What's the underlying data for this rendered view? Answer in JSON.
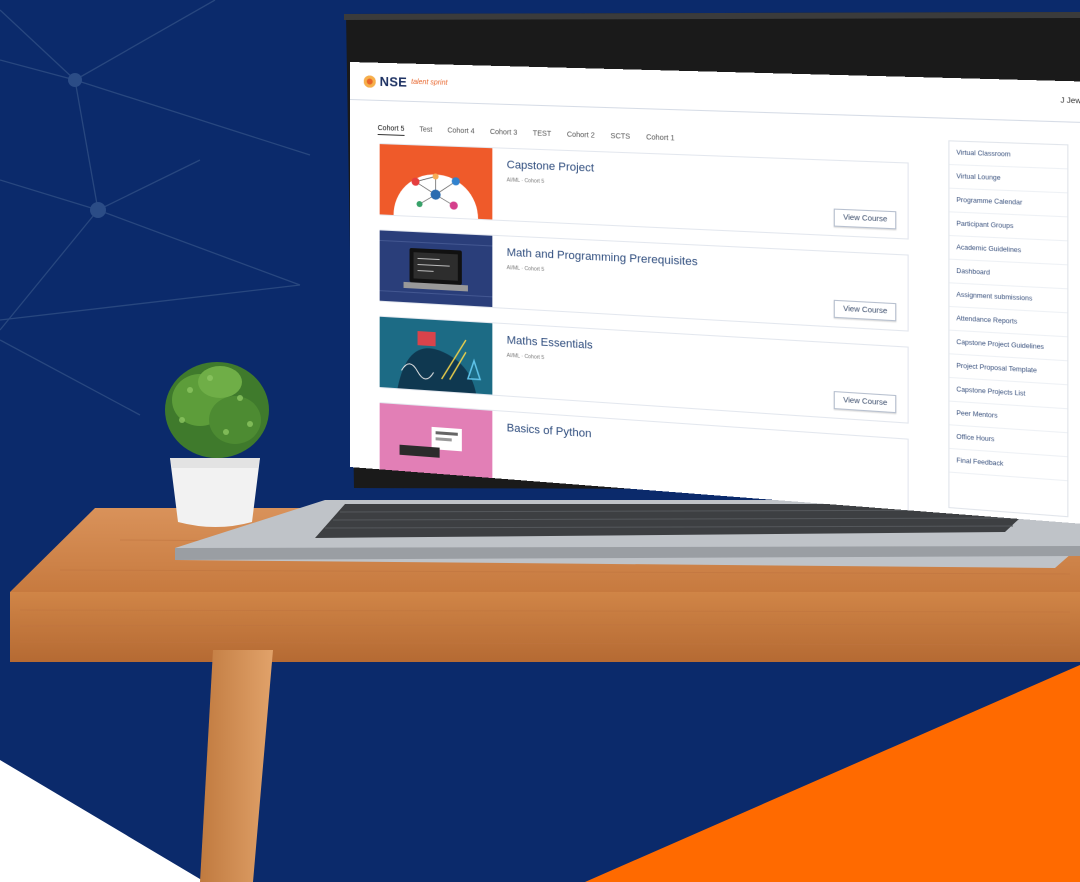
{
  "header": {
    "logo_text": "NSE",
    "logo_subtext": "talent sprint",
    "user_name": "J Jewell",
    "caret": "▾"
  },
  "tabs": [
    {
      "label": "Cohort 5",
      "active": true
    },
    {
      "label": "Test",
      "active": false
    },
    {
      "label": "Cohort 4",
      "active": false
    },
    {
      "label": "Cohort 3",
      "active": false
    },
    {
      "label": "TEST",
      "active": false
    },
    {
      "label": "Cohort 2",
      "active": false
    },
    {
      "label": "SCTS",
      "active": false
    },
    {
      "label": "Cohort 1",
      "active": false
    }
  ],
  "courses": [
    {
      "title": "Capstone Project",
      "subtitle": "AI/ML · Cohort 5",
      "button": "View Course"
    },
    {
      "title": "Math and Programming Prerequisites",
      "subtitle": "AI/ML · Cohort 5",
      "button": "View Course"
    },
    {
      "title": "Maths Essentials",
      "subtitle": "AI/ML · Cohort 5",
      "button": "View Course"
    },
    {
      "title": "Basics of Python",
      "subtitle": "",
      "button": ""
    }
  ],
  "sidebar": {
    "items": [
      {
        "label": "Virtual Classroom"
      },
      {
        "label": "Virtual Lounge"
      },
      {
        "label": "Programme Calendar"
      },
      {
        "label": "Participant Groups"
      },
      {
        "label": "Academic Guidelines"
      },
      {
        "label": "Dashboard"
      },
      {
        "label": "Assignment submissions"
      },
      {
        "label": "Attendance Reports"
      },
      {
        "label": "Capstone Project Guidelines"
      },
      {
        "label": "Project Proposal Template"
      },
      {
        "label": "Capstone Projects List"
      },
      {
        "label": "Peer Mentors"
      },
      {
        "label": "Office Hours"
      },
      {
        "label": "Final Feedback"
      }
    ]
  },
  "colors": {
    "background_navy": "#0b2a6b",
    "accent_orange": "#ff6a00",
    "link_blue": "#2f4d7e"
  }
}
